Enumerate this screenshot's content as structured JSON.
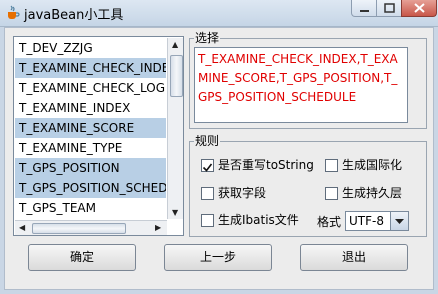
{
  "window": {
    "title": "javaBean小工具"
  },
  "tables": {
    "items": [
      {
        "label": "T_DEV_ZZJG",
        "selected": false
      },
      {
        "label": "T_EXAMINE_CHECK_INDEX",
        "selected": true
      },
      {
        "label": "T_EXAMINE_CHECK_LOG",
        "selected": false
      },
      {
        "label": "T_EXAMINE_INDEX",
        "selected": false
      },
      {
        "label": "T_EXAMINE_SCORE",
        "selected": true
      },
      {
        "label": "T_EXAMINE_TYPE",
        "selected": false
      },
      {
        "label": "T_GPS_POSITION",
        "selected": true
      },
      {
        "label": "T_GPS_POSITION_SCHEDULE",
        "selected": true
      },
      {
        "label": "T_GPS_TEAM",
        "selected": false
      }
    ]
  },
  "selection_panel": {
    "title": "选择",
    "text": "T_EXAMINE_CHECK_INDEX,T_EXAMINE_SCORE,T_GPS_POSITION,T_GPS_POSITION_SCHEDULE"
  },
  "rules_panel": {
    "title": "规则",
    "override_tostring": {
      "label": "是否重写toString",
      "checked": true
    },
    "generate_i18n": {
      "label": "生成国际化",
      "checked": false
    },
    "get_fields": {
      "label": "获取字段",
      "checked": false
    },
    "generate_persistence": {
      "label": "生成持久层",
      "checked": false
    },
    "generate_ibatis": {
      "label": "生成Ibatis文件",
      "checked": false
    },
    "format": {
      "label": "格式",
      "value": "UTF-8"
    }
  },
  "buttons": {
    "confirm": "确定",
    "previous": "上一步",
    "exit": "退出"
  },
  "colors": {
    "selection_text": "#e00000",
    "list_selected_bg": "#b8cfe5"
  },
  "icons": {
    "app": "java-cup-icon",
    "checkmark": "checkmark-icon",
    "dropdown": "chevron-down-icon"
  }
}
